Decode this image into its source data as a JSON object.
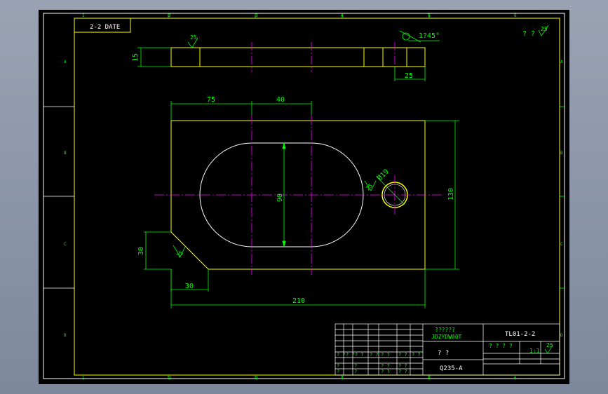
{
  "view_label": "2-2 DATE",
  "corner_note": "? ?",
  "roughness_symbols": [
    "25",
    "25",
    "25",
    "25",
    "25"
  ],
  "chamfer_note": "1?45°",
  "dimensions": {
    "thickness": "15",
    "slot_width": "25",
    "hole_offset_x": "75",
    "slot_span": "40",
    "slot_height": "90",
    "plate_height": "130",
    "plate_width": "210",
    "corner_v": "30",
    "corner_h": "30",
    "hole_diameter": "Ø19"
  },
  "zones": {
    "top": [
      "1",
      "2",
      "3",
      "4",
      "5",
      "6"
    ],
    "bottom": [
      "1",
      "2",
      "3",
      "4",
      "5",
      "6"
    ],
    "left": [
      "A",
      "B",
      "C",
      "D"
    ],
    "right": [
      "A",
      "B",
      "C",
      "D"
    ]
  },
  "title_block": {
    "company": "??????",
    "company_sub": "JDZYDW00T",
    "drawing_no": "TL01-2-2",
    "part_name": "? ?",
    "material": "Q235-A",
    "scale_header": "? ? ? ?",
    "scale_value": "1:1"
  }
}
